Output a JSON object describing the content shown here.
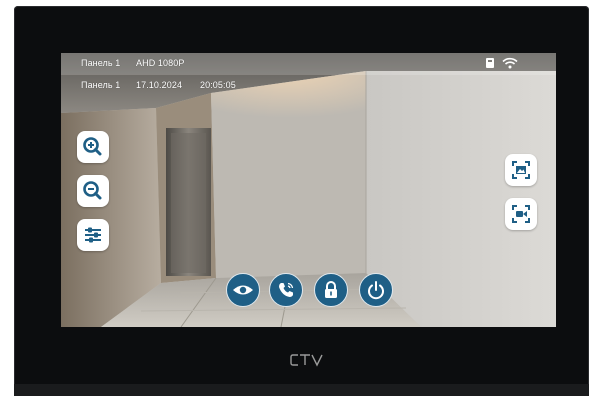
{
  "status_bar": {
    "line1_channel": "Панель 1",
    "line1_resolution": "AHD 1080P",
    "line2_channel": "Панель 1",
    "line2_date": "17.10.2024",
    "line2_time": "20:05:05",
    "icons": [
      "sd-card-icon",
      "wifi-icon"
    ]
  },
  "left_controls": [
    {
      "name": "zoom-in-button",
      "icon": "zoom-in-icon"
    },
    {
      "name": "zoom-out-button",
      "icon": "zoom-out-icon"
    },
    {
      "name": "image-settings-button",
      "icon": "sliders-icon"
    }
  ],
  "right_controls": [
    {
      "name": "snapshot-button",
      "icon": "photo-capture-icon"
    },
    {
      "name": "video-record-button",
      "icon": "video-capture-icon"
    }
  ],
  "bottom_controls": [
    {
      "name": "monitor-button",
      "icon": "eye-icon"
    },
    {
      "name": "talk-button",
      "icon": "phone-icon"
    },
    {
      "name": "unlock-button",
      "icon": "lock-icon"
    },
    {
      "name": "hang-up-button",
      "icon": "power-icon"
    }
  ],
  "colors": {
    "bezel": "#0c0d0f",
    "button_accent": "#1f5f86",
    "button_bg": "#ffffff"
  },
  "brand": {
    "logo_text": "CTV"
  }
}
